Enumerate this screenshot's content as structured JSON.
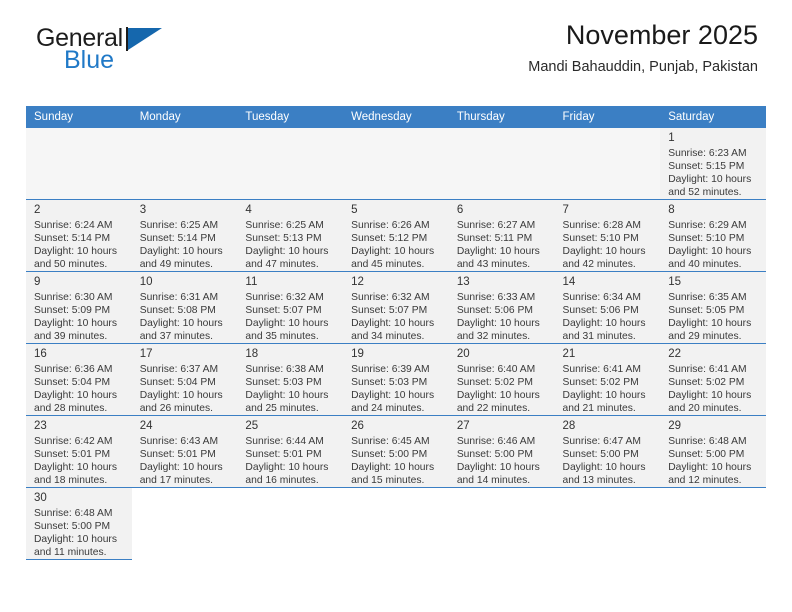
{
  "brand": {
    "name_part1": "General",
    "name_part2": "Blue",
    "accent_color": "#2079c7",
    "flag_icon": "flag-triangle-icon"
  },
  "header": {
    "title": "November 2025",
    "subtitle": "Mandi Bahauddin, Punjab, Pakistan"
  },
  "calendar": {
    "header_bg": "#3b7fc4",
    "header_text_color": "#ffffff",
    "weekdays": [
      "Sunday",
      "Monday",
      "Tuesday",
      "Wednesday",
      "Thursday",
      "Friday",
      "Saturday"
    ],
    "weeks": [
      [
        {
          "blank": true
        },
        {
          "blank": true
        },
        {
          "blank": true
        },
        {
          "blank": true
        },
        {
          "blank": true
        },
        {
          "blank": true
        },
        {
          "day": "1",
          "sunrise": "Sunrise: 6:23 AM",
          "sunset": "Sunset: 5:15 PM",
          "daylight1": "Daylight: 10 hours",
          "daylight2": "and 52 minutes."
        }
      ],
      [
        {
          "day": "2",
          "sunrise": "Sunrise: 6:24 AM",
          "sunset": "Sunset: 5:14 PM",
          "daylight1": "Daylight: 10 hours",
          "daylight2": "and 50 minutes."
        },
        {
          "day": "3",
          "sunrise": "Sunrise: 6:25 AM",
          "sunset": "Sunset: 5:14 PM",
          "daylight1": "Daylight: 10 hours",
          "daylight2": "and 49 minutes."
        },
        {
          "day": "4",
          "sunrise": "Sunrise: 6:25 AM",
          "sunset": "Sunset: 5:13 PM",
          "daylight1": "Daylight: 10 hours",
          "daylight2": "and 47 minutes."
        },
        {
          "day": "5",
          "sunrise": "Sunrise: 6:26 AM",
          "sunset": "Sunset: 5:12 PM",
          "daylight1": "Daylight: 10 hours",
          "daylight2": "and 45 minutes."
        },
        {
          "day": "6",
          "sunrise": "Sunrise: 6:27 AM",
          "sunset": "Sunset: 5:11 PM",
          "daylight1": "Daylight: 10 hours",
          "daylight2": "and 43 minutes."
        },
        {
          "day": "7",
          "sunrise": "Sunrise: 6:28 AM",
          "sunset": "Sunset: 5:10 PM",
          "daylight1": "Daylight: 10 hours",
          "daylight2": "and 42 minutes."
        },
        {
          "day": "8",
          "sunrise": "Sunrise: 6:29 AM",
          "sunset": "Sunset: 5:10 PM",
          "daylight1": "Daylight: 10 hours",
          "daylight2": "and 40 minutes."
        }
      ],
      [
        {
          "day": "9",
          "sunrise": "Sunrise: 6:30 AM",
          "sunset": "Sunset: 5:09 PM",
          "daylight1": "Daylight: 10 hours",
          "daylight2": "and 39 minutes."
        },
        {
          "day": "10",
          "sunrise": "Sunrise: 6:31 AM",
          "sunset": "Sunset: 5:08 PM",
          "daylight1": "Daylight: 10 hours",
          "daylight2": "and 37 minutes."
        },
        {
          "day": "11",
          "sunrise": "Sunrise: 6:32 AM",
          "sunset": "Sunset: 5:07 PM",
          "daylight1": "Daylight: 10 hours",
          "daylight2": "and 35 minutes."
        },
        {
          "day": "12",
          "sunrise": "Sunrise: 6:32 AM",
          "sunset": "Sunset: 5:07 PM",
          "daylight1": "Daylight: 10 hours",
          "daylight2": "and 34 minutes."
        },
        {
          "day": "13",
          "sunrise": "Sunrise: 6:33 AM",
          "sunset": "Sunset: 5:06 PM",
          "daylight1": "Daylight: 10 hours",
          "daylight2": "and 32 minutes."
        },
        {
          "day": "14",
          "sunrise": "Sunrise: 6:34 AM",
          "sunset": "Sunset: 5:06 PM",
          "daylight1": "Daylight: 10 hours",
          "daylight2": "and 31 minutes."
        },
        {
          "day": "15",
          "sunrise": "Sunrise: 6:35 AM",
          "sunset": "Sunset: 5:05 PM",
          "daylight1": "Daylight: 10 hours",
          "daylight2": "and 29 minutes."
        }
      ],
      [
        {
          "day": "16",
          "sunrise": "Sunrise: 6:36 AM",
          "sunset": "Sunset: 5:04 PM",
          "daylight1": "Daylight: 10 hours",
          "daylight2": "and 28 minutes."
        },
        {
          "day": "17",
          "sunrise": "Sunrise: 6:37 AM",
          "sunset": "Sunset: 5:04 PM",
          "daylight1": "Daylight: 10 hours",
          "daylight2": "and 26 minutes."
        },
        {
          "day": "18",
          "sunrise": "Sunrise: 6:38 AM",
          "sunset": "Sunset: 5:03 PM",
          "daylight1": "Daylight: 10 hours",
          "daylight2": "and 25 minutes."
        },
        {
          "day": "19",
          "sunrise": "Sunrise: 6:39 AM",
          "sunset": "Sunset: 5:03 PM",
          "daylight1": "Daylight: 10 hours",
          "daylight2": "and 24 minutes."
        },
        {
          "day": "20",
          "sunrise": "Sunrise: 6:40 AM",
          "sunset": "Sunset: 5:02 PM",
          "daylight1": "Daylight: 10 hours",
          "daylight2": "and 22 minutes."
        },
        {
          "day": "21",
          "sunrise": "Sunrise: 6:41 AM",
          "sunset": "Sunset: 5:02 PM",
          "daylight1": "Daylight: 10 hours",
          "daylight2": "and 21 minutes."
        },
        {
          "day": "22",
          "sunrise": "Sunrise: 6:41 AM",
          "sunset": "Sunset: 5:02 PM",
          "daylight1": "Daylight: 10 hours",
          "daylight2": "and 20 minutes."
        }
      ],
      [
        {
          "day": "23",
          "sunrise": "Sunrise: 6:42 AM",
          "sunset": "Sunset: 5:01 PM",
          "daylight1": "Daylight: 10 hours",
          "daylight2": "and 18 minutes."
        },
        {
          "day": "24",
          "sunrise": "Sunrise: 6:43 AM",
          "sunset": "Sunset: 5:01 PM",
          "daylight1": "Daylight: 10 hours",
          "daylight2": "and 17 minutes."
        },
        {
          "day": "25",
          "sunrise": "Sunrise: 6:44 AM",
          "sunset": "Sunset: 5:01 PM",
          "daylight1": "Daylight: 10 hours",
          "daylight2": "and 16 minutes."
        },
        {
          "day": "26",
          "sunrise": "Sunrise: 6:45 AM",
          "sunset": "Sunset: 5:00 PM",
          "daylight1": "Daylight: 10 hours",
          "daylight2": "and 15 minutes."
        },
        {
          "day": "27",
          "sunrise": "Sunrise: 6:46 AM",
          "sunset": "Sunset: 5:00 PM",
          "daylight1": "Daylight: 10 hours",
          "daylight2": "and 14 minutes."
        },
        {
          "day": "28",
          "sunrise": "Sunrise: 6:47 AM",
          "sunset": "Sunset: 5:00 PM",
          "daylight1": "Daylight: 10 hours",
          "daylight2": "and 13 minutes."
        },
        {
          "day": "29",
          "sunrise": "Sunrise: 6:48 AM",
          "sunset": "Sunset: 5:00 PM",
          "daylight1": "Daylight: 10 hours",
          "daylight2": "and 12 minutes."
        }
      ],
      [
        {
          "day": "30",
          "sunrise": "Sunrise: 6:48 AM",
          "sunset": "Sunset: 5:00 PM",
          "daylight1": "Daylight: 10 hours",
          "daylight2": "and 11 minutes."
        },
        {
          "empty": true
        },
        {
          "empty": true
        },
        {
          "empty": true
        },
        {
          "empty": true
        },
        {
          "empty": true
        },
        {
          "empty": true
        }
      ]
    ]
  }
}
